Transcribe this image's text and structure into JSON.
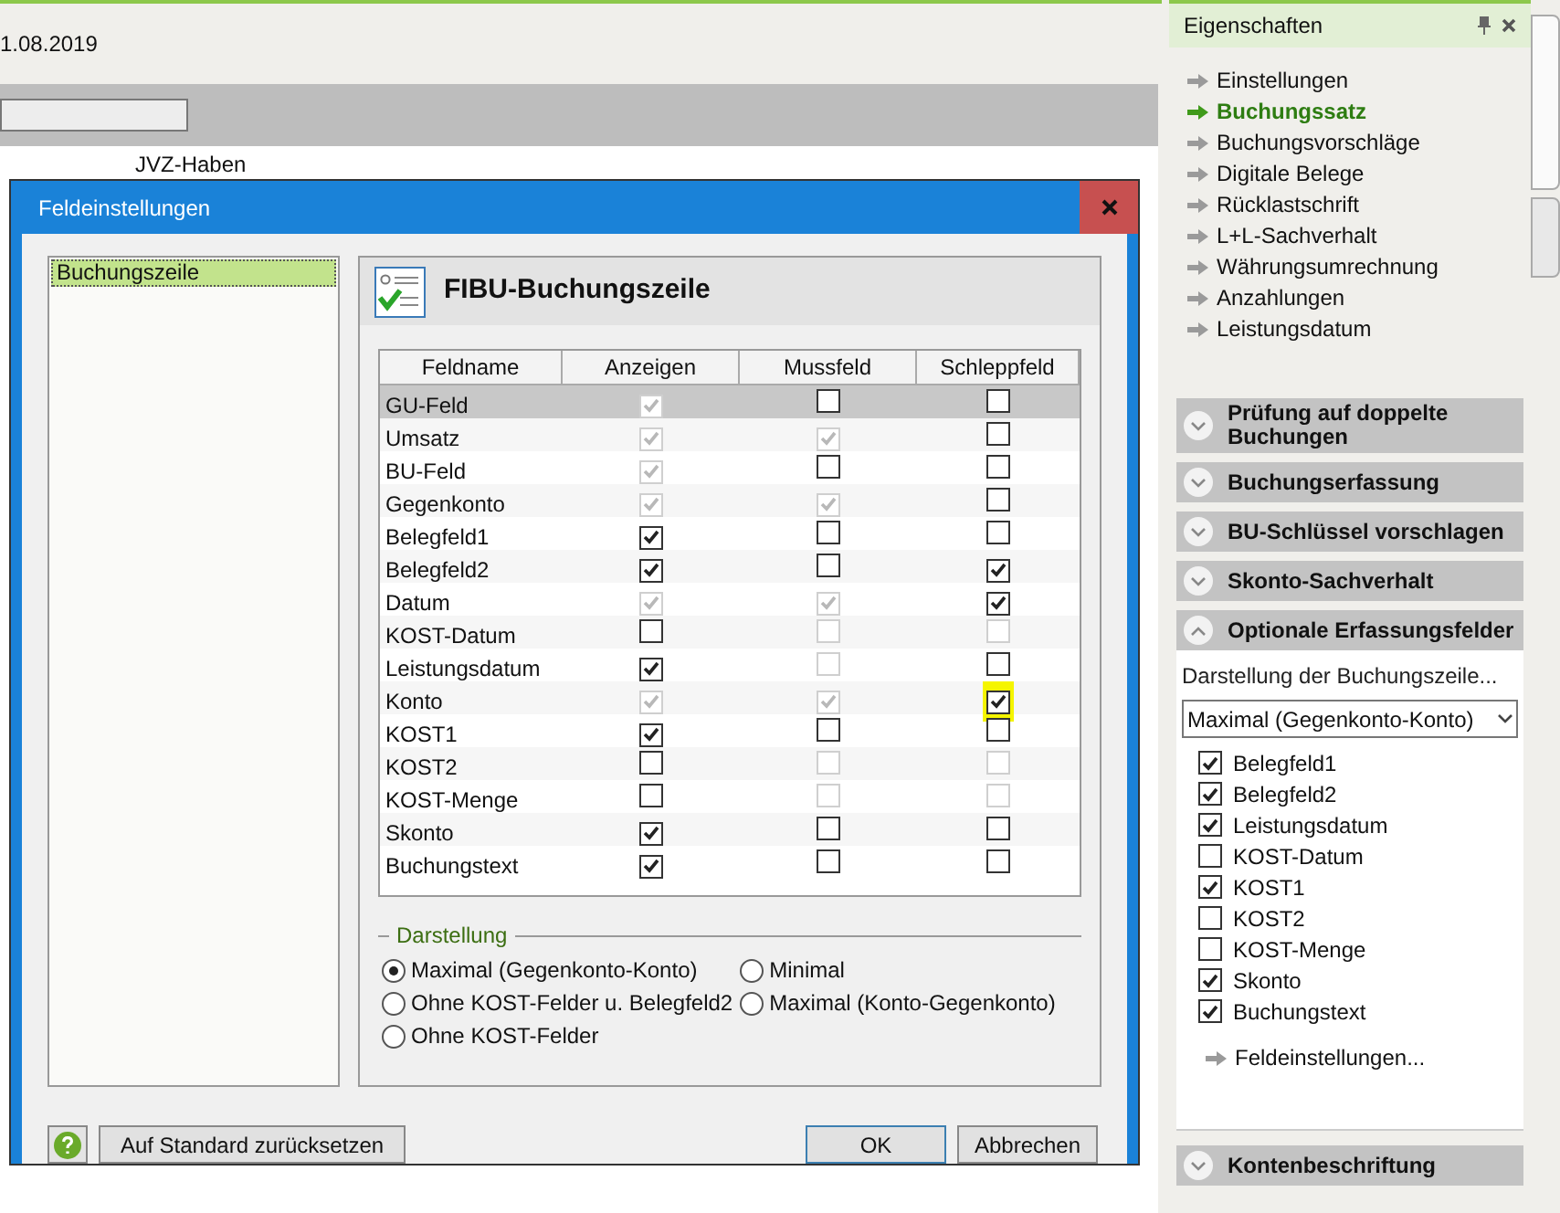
{
  "background": {
    "date": "1.08.2019",
    "column_label": "JVZ-Haben"
  },
  "dialog": {
    "title": "Feldeinstellungen",
    "tree": [
      {
        "label": "Buchungszeile",
        "selected": true
      }
    ],
    "header": "FIBU-Buchungszeile",
    "table": {
      "columns": [
        "Feldname",
        "Anzeigen",
        "Mussfeld",
        "Schleppfeld"
      ],
      "rows": [
        {
          "name": "GU-Feld",
          "selected": true,
          "cells": [
            {
              "checked": true,
              "disabled": true
            },
            {
              "checked": false,
              "disabled": false
            },
            {
              "checked": false,
              "disabled": false
            }
          ]
        },
        {
          "name": "Umsatz",
          "selected": false,
          "cells": [
            {
              "checked": true,
              "disabled": true
            },
            {
              "checked": true,
              "disabled": true
            },
            {
              "checked": false,
              "disabled": false
            }
          ]
        },
        {
          "name": "BU-Feld",
          "selected": false,
          "cells": [
            {
              "checked": true,
              "disabled": true
            },
            {
              "checked": false,
              "disabled": false
            },
            {
              "checked": false,
              "disabled": false
            }
          ]
        },
        {
          "name": "Gegenkonto",
          "selected": false,
          "cells": [
            {
              "checked": true,
              "disabled": true
            },
            {
              "checked": true,
              "disabled": true
            },
            {
              "checked": false,
              "disabled": false
            }
          ]
        },
        {
          "name": "Belegfeld1",
          "selected": false,
          "cells": [
            {
              "checked": true,
              "disabled": false
            },
            {
              "checked": false,
              "disabled": false
            },
            {
              "checked": false,
              "disabled": false
            }
          ]
        },
        {
          "name": "Belegfeld2",
          "selected": false,
          "cells": [
            {
              "checked": true,
              "disabled": false
            },
            {
              "checked": false,
              "disabled": false
            },
            {
              "checked": true,
              "disabled": false
            }
          ]
        },
        {
          "name": "Datum",
          "selected": false,
          "cells": [
            {
              "checked": true,
              "disabled": true
            },
            {
              "checked": true,
              "disabled": true
            },
            {
              "checked": true,
              "disabled": false
            }
          ]
        },
        {
          "name": "KOST-Datum",
          "selected": false,
          "cells": [
            {
              "checked": false,
              "disabled": false
            },
            {
              "checked": false,
              "disabled": true
            },
            {
              "checked": false,
              "disabled": true
            }
          ]
        },
        {
          "name": "Leistungsdatum",
          "selected": false,
          "cells": [
            {
              "checked": true,
              "disabled": false
            },
            {
              "checked": false,
              "disabled": true
            },
            {
              "checked": false,
              "disabled": false
            }
          ]
        },
        {
          "name": "Konto",
          "selected": false,
          "cells": [
            {
              "checked": true,
              "disabled": true
            },
            {
              "checked": true,
              "disabled": true
            },
            {
              "checked": true,
              "disabled": false,
              "highlighted": true
            }
          ]
        },
        {
          "name": "KOST1",
          "selected": false,
          "cells": [
            {
              "checked": true,
              "disabled": false
            },
            {
              "checked": false,
              "disabled": false
            },
            {
              "checked": false,
              "disabled": false
            }
          ]
        },
        {
          "name": "KOST2",
          "selected": false,
          "cells": [
            {
              "checked": false,
              "disabled": false
            },
            {
              "checked": false,
              "disabled": true
            },
            {
              "checked": false,
              "disabled": true
            }
          ]
        },
        {
          "name": "KOST-Menge",
          "selected": false,
          "cells": [
            {
              "checked": false,
              "disabled": false
            },
            {
              "checked": false,
              "disabled": true
            },
            {
              "checked": false,
              "disabled": true
            }
          ]
        },
        {
          "name": "Skonto",
          "selected": false,
          "cells": [
            {
              "checked": true,
              "disabled": false
            },
            {
              "checked": false,
              "disabled": false
            },
            {
              "checked": false,
              "disabled": false
            }
          ]
        },
        {
          "name": "Buchungstext",
          "selected": false,
          "cells": [
            {
              "checked": true,
              "disabled": false
            },
            {
              "checked": false,
              "disabled": false
            },
            {
              "checked": false,
              "disabled": false
            }
          ]
        }
      ]
    },
    "display_group": {
      "title": "Darstellung",
      "options": [
        {
          "label": "Maximal (Gegenkonto-Konto)",
          "selected": true
        },
        {
          "label": "Minimal",
          "selected": false
        },
        {
          "label": "Ohne KOST-Felder u. Belegfeld2",
          "selected": false
        },
        {
          "label": "Maximal (Konto-Gegenkonto)",
          "selected": false
        },
        {
          "label": "Ohne KOST-Felder",
          "selected": false
        }
      ]
    },
    "buttons": [
      "Auf Standard zurücksetzen",
      "OK",
      "Abbrechen"
    ]
  },
  "properties": {
    "title": "Eigenschaften",
    "links": [
      {
        "label": "Einstellungen",
        "selected": false
      },
      {
        "label": "Buchungssatz",
        "selected": true
      },
      {
        "label": "Buchungsvorschläge",
        "selected": false
      },
      {
        "label": "Digitale Belege",
        "selected": false
      },
      {
        "label": "Rücklastschrift",
        "selected": false
      },
      {
        "label": "L+L-Sachverhalt",
        "selected": false
      },
      {
        "label": "Währungsumrechnung",
        "selected": false
      },
      {
        "label": "Anzahlungen",
        "selected": false
      },
      {
        "label": "Leistungsdatum",
        "selected": false
      }
    ],
    "sections": [
      {
        "title": "Prüfung auf doppelte Buchungen",
        "expanded": false
      },
      {
        "title": "Buchungserfassung",
        "expanded": false
      },
      {
        "title": "BU-Schlüssel vorschlagen",
        "expanded": false
      },
      {
        "title": "Skonto-Sachverhalt",
        "expanded": false
      },
      {
        "title": "Optionale Erfassungsfelder",
        "expanded": true,
        "label": "Darstellung der Buchungszeile...",
        "select_value": "Maximal (Gegenkonto-Konto)",
        "fields": [
          {
            "label": "Belegfeld1",
            "checked": true
          },
          {
            "label": "Belegfeld2",
            "checked": true
          },
          {
            "label": "Leistungsdatum",
            "checked": true
          },
          {
            "label": "KOST-Datum",
            "checked": false
          },
          {
            "label": "KOST1",
            "checked": true
          },
          {
            "label": "KOST2",
            "checked": false
          },
          {
            "label": "KOST-Menge",
            "checked": false
          },
          {
            "label": "Skonto",
            "checked": true
          },
          {
            "label": "Buchungstext",
            "checked": true
          }
        ],
        "link": "Feldeinstellungen..."
      },
      {
        "title": "Kontenbeschriftung",
        "expanded": false
      }
    ]
  }
}
